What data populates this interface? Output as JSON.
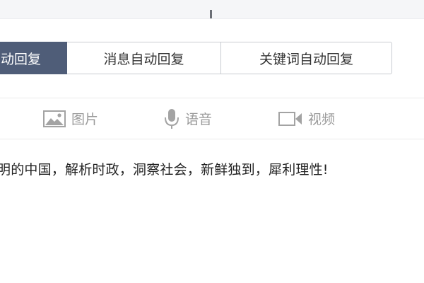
{
  "tabs": [
    {
      "label": "动回复",
      "active": true
    },
    {
      "label": "消息自动回复",
      "active": false
    },
    {
      "label": "关键词自动回复",
      "active": false
    }
  ],
  "media": {
    "image_label": "图片",
    "voice_label": "语音",
    "video_label": "视频",
    "image_icon": "image-icon",
    "voice_icon": "microphone-icon",
    "video_icon": "video-camera-icon"
  },
  "content": {
    "text": "明的中国，解析时政，洞察社会，新鲜独到，犀利理性!"
  },
  "colors": {
    "active_tab_bg": "#4f5d78",
    "icon_gray": "#9a9a9a"
  }
}
